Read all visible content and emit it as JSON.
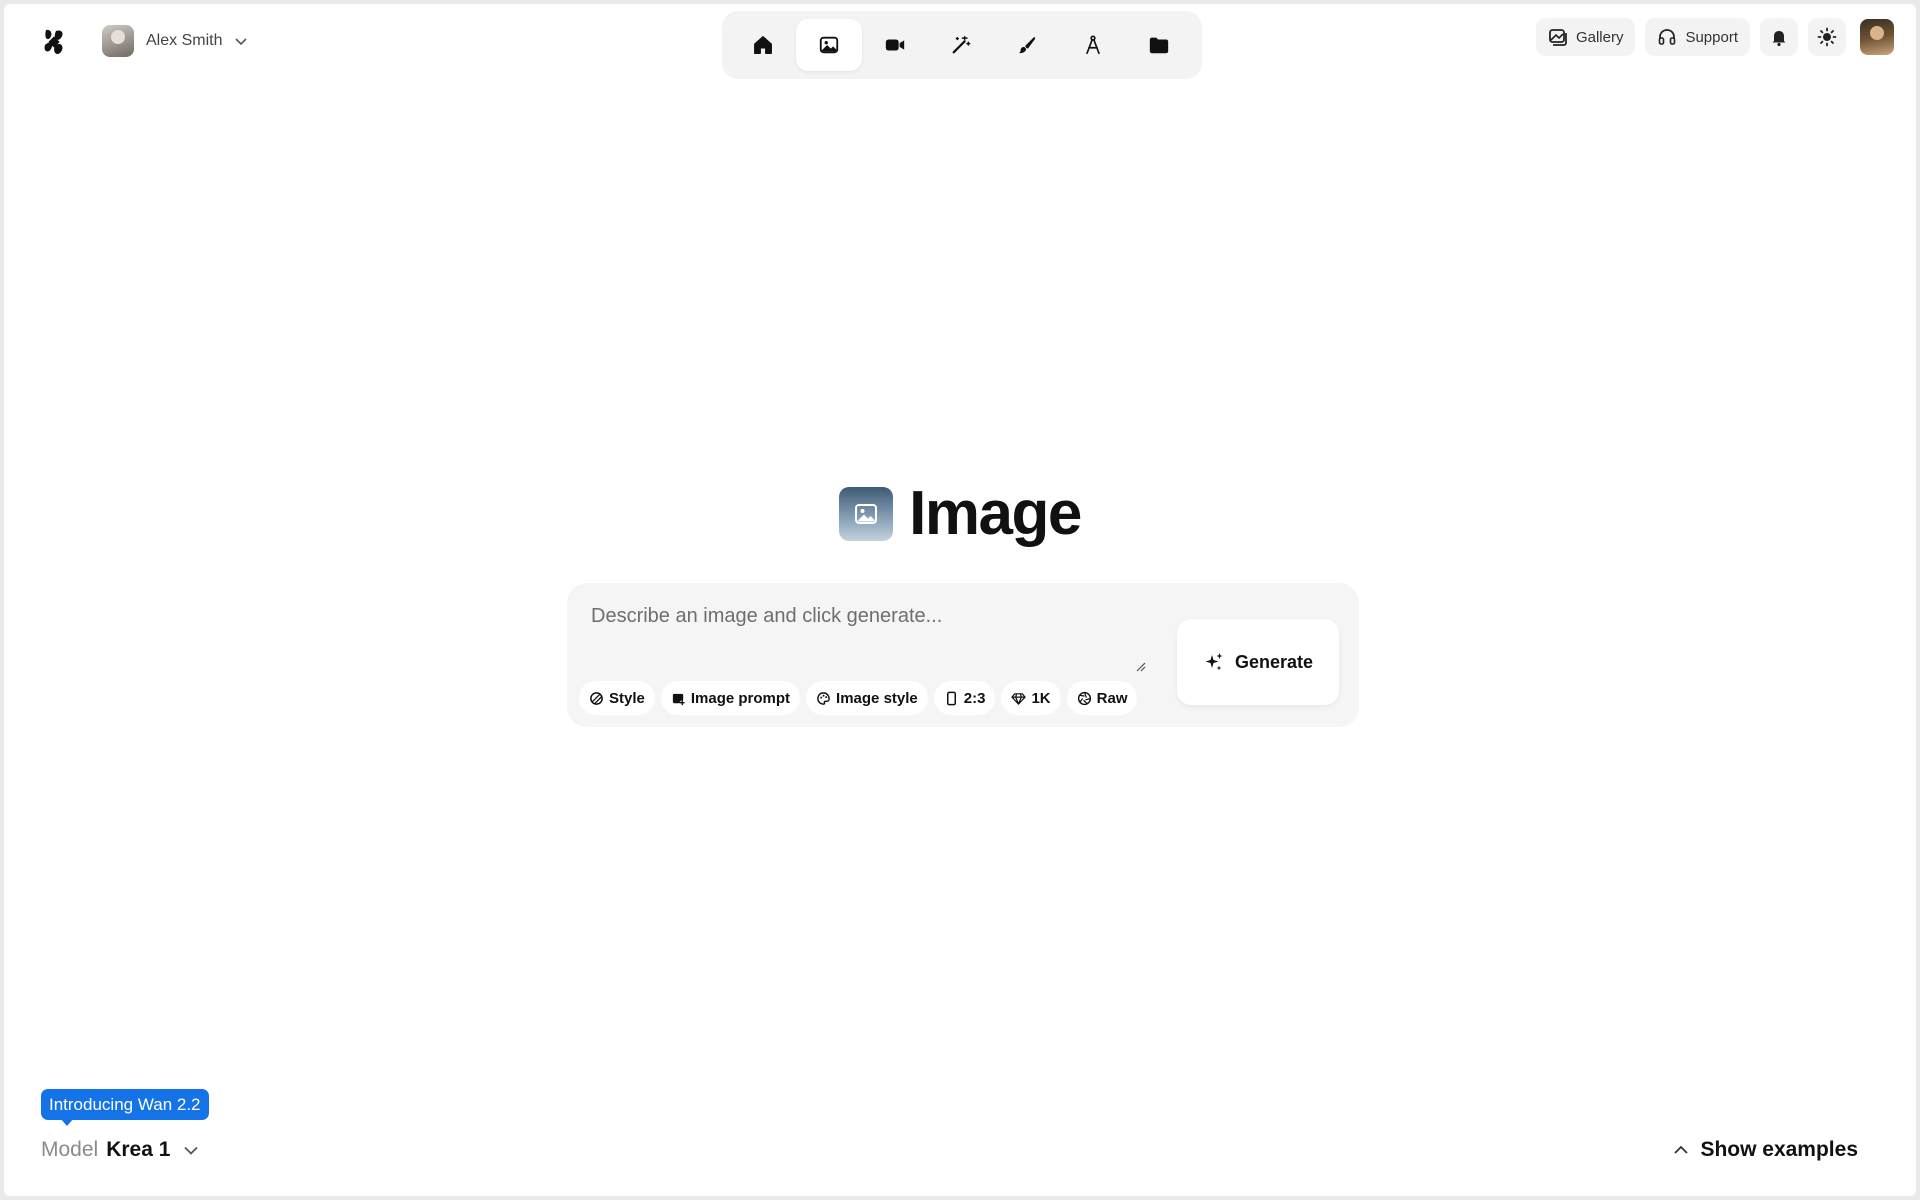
{
  "header": {
    "account_name": "Alex Smith",
    "tools": [
      {
        "name": "home",
        "active": false
      },
      {
        "name": "image",
        "active": true
      },
      {
        "name": "video",
        "active": false
      },
      {
        "name": "enhance",
        "active": false
      },
      {
        "name": "edit",
        "active": false
      },
      {
        "name": "train",
        "active": false
      },
      {
        "name": "assets",
        "active": false
      }
    ],
    "gallery_label": "Gallery",
    "support_label": "Support"
  },
  "hero": {
    "title": "Image"
  },
  "prompt": {
    "placeholder": "Describe an image and click generate...",
    "value": "",
    "chips": {
      "style": "Style",
      "image_prompt": "Image prompt",
      "image_style": "Image style",
      "aspect_ratio": "2:3",
      "resolution": "1K",
      "raw": "Raw"
    },
    "generate_label": "Generate"
  },
  "footer": {
    "announcement": "Introducing Wan 2.2",
    "model_label": "Model",
    "model_value": "Krea 1",
    "show_examples_label": "Show examples"
  },
  "colors": {
    "accent_blue": "#1473e6",
    "background": "#ffffff",
    "panel": "#f3f3f3"
  }
}
